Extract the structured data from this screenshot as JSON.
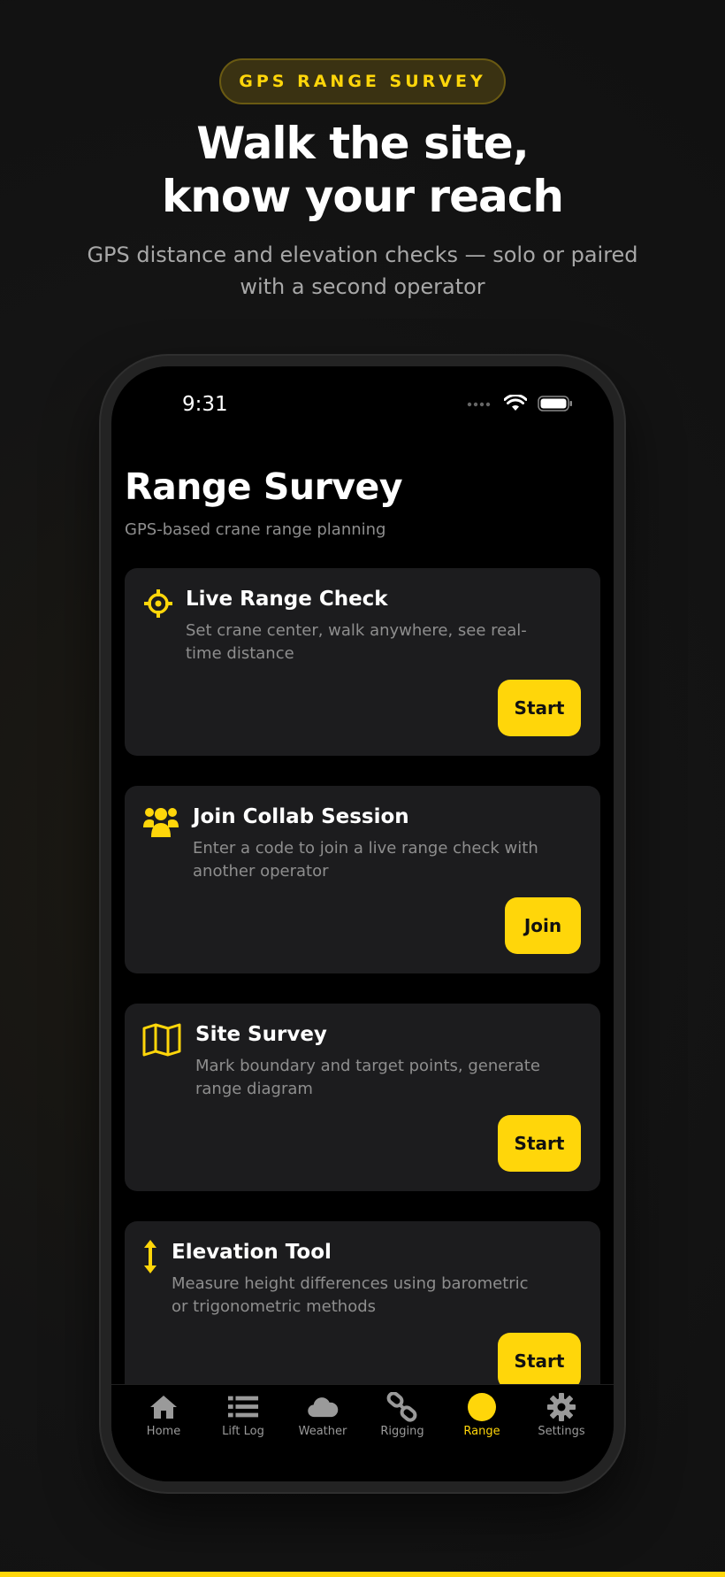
{
  "colors": {
    "accent": "#ffd60a",
    "card": "#1c1c1e",
    "muted": "#8e8e8e"
  },
  "hero": {
    "pill_label": "GPS RANGE SURVEY",
    "headline_line1": "Walk the site,",
    "headline_line2": "know your reach",
    "subhead": "GPS distance and elevation checks — solo or paired with a second operator"
  },
  "status_bar": {
    "time": "9:31",
    "icons": [
      "signal-icon",
      "wifi-icon",
      "battery-icon"
    ]
  },
  "screen": {
    "title": "Range Survey",
    "subtitle": "GPS-based crane range planning"
  },
  "cards": [
    {
      "icon": "crosshair-icon",
      "title": "Live Range Check",
      "description": "Set crane center, walk anywhere, see real-time distance",
      "button": "Start"
    },
    {
      "icon": "users-icon",
      "title": "Join Collab Session",
      "description": "Enter a code to join a live range check with another operator",
      "button": "Join"
    },
    {
      "icon": "map-icon",
      "title": "Site Survey",
      "description": "Mark boundary and target points, generate range diagram",
      "button": "Start"
    },
    {
      "icon": "elevation-arrows-icon",
      "title": "Elevation Tool",
      "description": "Measure height differences using barometric or trigonometric methods",
      "button": "Start"
    }
  ],
  "tabs": [
    {
      "label": "Home",
      "icon": "home-icon"
    },
    {
      "label": "Lift Log",
      "icon": "list-icon"
    },
    {
      "label": "Weather",
      "icon": "cloud-icon"
    },
    {
      "label": "Rigging",
      "icon": "chain-link-icon"
    },
    {
      "label": "Range",
      "icon": "range-dot-icon",
      "active": true
    },
    {
      "label": "Settings",
      "icon": "gear-icon"
    }
  ]
}
